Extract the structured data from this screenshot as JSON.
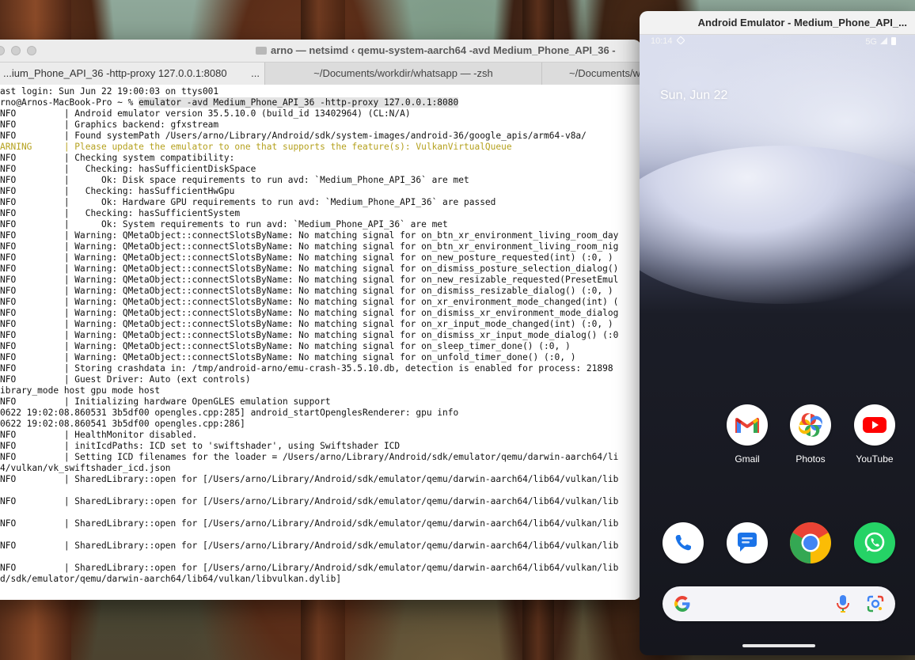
{
  "terminal": {
    "title": "arno — netsimd ‹ qemu-system-aarch64 -avd Medium_Phone_API_36 -",
    "tabs": [
      {
        "label": "...ium_Phone_API_36 -http-proxy 127.0.0.1:8080",
        "active": true
      },
      {
        "label": "~/Documents/workdir/whatsapp — -zsh",
        "active": false
      },
      {
        "label": "~/Documents/w",
        "active": false
      }
    ],
    "tab_more": "...",
    "lines": [
      {
        "text": "ast login: Sun Jun 22 19:00:03 on ttys001",
        "warn": false
      },
      {
        "prompt": "rno@Arnos-MacBook-Pro ~ % ",
        "command": "emulator -avd Medium_Phone_API_36 -http-proxy 127.0.0.1:8080"
      },
      {
        "text": "NFO         | Android emulator version 35.5.10.0 (build_id 13402964) (CL:N/A)",
        "warn": false
      },
      {
        "text": "NFO         | Graphics backend: gfxstream",
        "warn": false
      },
      {
        "text": "NFO         | Found systemPath /Users/arno/Library/Android/sdk/system-images/android-36/google_apis/arm64-v8a/",
        "warn": false
      },
      {
        "text": "ARNING      | Please update the emulator to one that supports the feature(s): VulkanVirtualQueue",
        "warn": true
      },
      {
        "text": "NFO         | Checking system compatibility:",
        "warn": false
      },
      {
        "text": "NFO         |   Checking: hasSufficientDiskSpace",
        "warn": false
      },
      {
        "text": "NFO         |      Ok: Disk space requirements to run avd: `Medium_Phone_API_36` are met",
        "warn": false
      },
      {
        "text": "NFO         |   Checking: hasSufficientHwGpu",
        "warn": false
      },
      {
        "text": "NFO         |      Ok: Hardware GPU requirements to run avd: `Medium_Phone_API_36` are passed",
        "warn": false
      },
      {
        "text": "NFO         |   Checking: hasSufficientSystem",
        "warn": false
      },
      {
        "text": "NFO         |      Ok: System requirements to run avd: `Medium_Phone_API_36` are met",
        "warn": false
      },
      {
        "text": "NFO         | Warning: QMetaObject::connectSlotsByName: No matching signal for on_btn_xr_environment_living_room_day",
        "warn": false
      },
      {
        "text": "NFO         | Warning: QMetaObject::connectSlotsByName: No matching signal for on_btn_xr_environment_living_room_nig",
        "warn": false
      },
      {
        "text": "NFO         | Warning: QMetaObject::connectSlotsByName: No matching signal for on_new_posture_requested(int) (:0, )",
        "warn": false
      },
      {
        "text": "NFO         | Warning: QMetaObject::connectSlotsByName: No matching signal for on_dismiss_posture_selection_dialog()",
        "warn": false
      },
      {
        "text": "NFO         | Warning: QMetaObject::connectSlotsByName: No matching signal for on_new_resizable_requested(PresetEmul",
        "warn": false
      },
      {
        "text": "NFO         | Warning: QMetaObject::connectSlotsByName: No matching signal for on_dismiss_resizable_dialog() (:0, )",
        "warn": false
      },
      {
        "text": "NFO         | Warning: QMetaObject::connectSlotsByName: No matching signal for on_xr_environment_mode_changed(int) (",
        "warn": false
      },
      {
        "text": "NFO         | Warning: QMetaObject::connectSlotsByName: No matching signal for on_dismiss_xr_environment_mode_dialog",
        "warn": false
      },
      {
        "text": "NFO         | Warning: QMetaObject::connectSlotsByName: No matching signal for on_xr_input_mode_changed(int) (:0, )",
        "warn": false
      },
      {
        "text": "NFO         | Warning: QMetaObject::connectSlotsByName: No matching signal for on_dismiss_xr_input_mode_dialog() (:0",
        "warn": false
      },
      {
        "text": "NFO         | Warning: QMetaObject::connectSlotsByName: No matching signal for on_sleep_timer_done() (:0, )",
        "warn": false
      },
      {
        "text": "NFO         | Warning: QMetaObject::connectSlotsByName: No matching signal for on_unfold_timer_done() (:0, )",
        "warn": false
      },
      {
        "text": "NFO         | Storing crashdata in: /tmp/android-arno/emu-crash-35.5.10.db, detection is enabled for process: 21898",
        "warn": false
      },
      {
        "text": "NFO         | Guest Driver: Auto (ext controls)",
        "warn": false
      },
      {
        "text": "ibrary_mode host gpu mode host",
        "warn": false
      },
      {
        "text": "NFO         | Initializing hardware OpenGLES emulation support",
        "warn": false
      },
      {
        "text": "0622 19:02:08.860531 3b5df00 opengles.cpp:285] android_startOpenglesRenderer: gpu info",
        "warn": false
      },
      {
        "text": "0622 19:02:08.860541 3b5df00 opengles.cpp:286]",
        "warn": false
      },
      {
        "text": "NFO         | HealthMonitor disabled.",
        "warn": false
      },
      {
        "text": "NFO         | initIcdPaths: ICD set to 'swiftshader', using Swiftshader ICD",
        "warn": false
      },
      {
        "text": "NFO         | Setting ICD filenames for the loader = /Users/arno/Library/Android/sdk/emulator/qemu/darwin-aarch64/li",
        "warn": false
      },
      {
        "text": "4/vulkan/vk_swiftshader_icd.json",
        "warn": false
      },
      {
        "text": "NFO         | SharedLibrary::open for [/Users/arno/Library/Android/sdk/emulator/qemu/darwin-aarch64/lib64/vulkan/lib",
        "warn": false
      },
      {
        "text": "",
        "warn": false
      },
      {
        "text": "NFO         | SharedLibrary::open for [/Users/arno/Library/Android/sdk/emulator/qemu/darwin-aarch64/lib64/vulkan/lib",
        "warn": false
      },
      {
        "text": "",
        "warn": false
      },
      {
        "text": "NFO         | SharedLibrary::open for [/Users/arno/Library/Android/sdk/emulator/qemu/darwin-aarch64/lib64/vulkan/lib",
        "warn": false
      },
      {
        "text": "",
        "warn": false
      },
      {
        "text": "NFO         | SharedLibrary::open for [/Users/arno/Library/Android/sdk/emulator/qemu/darwin-aarch64/lib64/vulkan/lib",
        "warn": false
      },
      {
        "text": "",
        "warn": false
      },
      {
        "text": "NFO         | SharedLibrary::open for [/Users/arno/Library/Android/sdk/emulator/qemu/darwin-aarch64/lib64/vulkan/lib",
        "warn": false
      },
      {
        "text": "d/sdk/emulator/qemu/darwin-aarch64/lib64/vulkan/libvulkan.dylib]",
        "warn": false
      }
    ]
  },
  "emulator": {
    "title": "Android Emulator - Medium_Phone_API_...",
    "status": {
      "time": "10:14",
      "network": "5G"
    },
    "date": "Sun, Jun 22",
    "apps": [
      {
        "name": "gmail",
        "label": "Gmail"
      },
      {
        "name": "photos",
        "label": "Photos"
      },
      {
        "name": "youtube",
        "label": "YouTube"
      }
    ],
    "dock": [
      "phone",
      "messages",
      "chrome",
      "whatsapp"
    ],
    "colors": {
      "google_blue": "#4285F4",
      "google_red": "#EA4335",
      "google_yellow": "#FBBC05",
      "google_green": "#34A853",
      "whatsapp": "#25D366",
      "youtube": "#FF0000"
    }
  }
}
